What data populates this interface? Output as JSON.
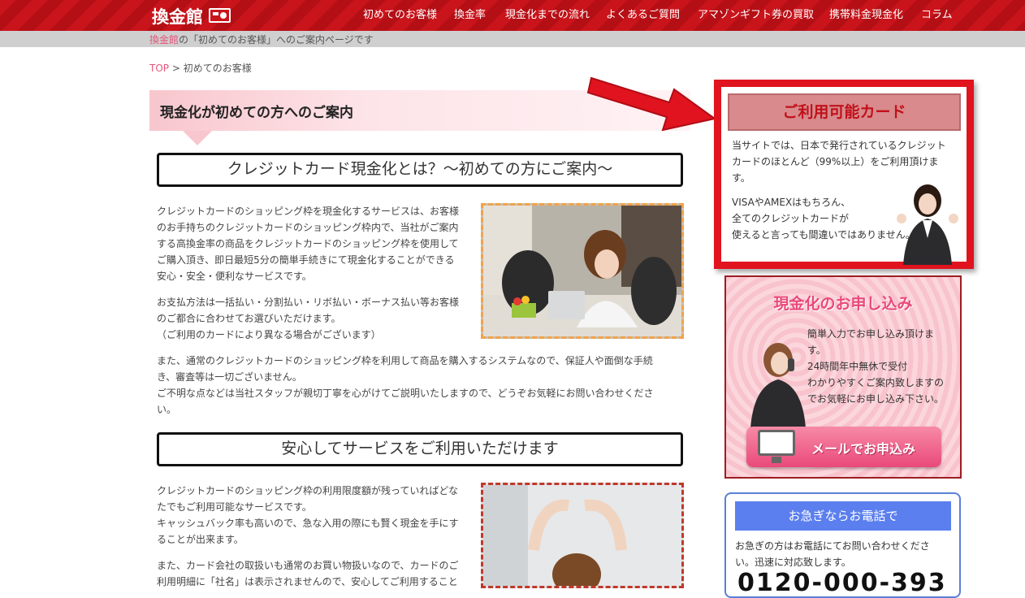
{
  "header": {
    "logo": "換金館",
    "nav": [
      "初めてのお客様",
      "換金率",
      "現金化までの流れ",
      "よくあるご質問",
      "アマゾンギフト券の買取",
      "携帯料金現金化",
      "コラム"
    ]
  },
  "subbar": {
    "site": "換金館",
    "rest": "の「初めてのお客様」へのご案内ページです"
  },
  "breadcrumb": {
    "top": "TOP",
    "sep": ">",
    "current": "初めてのお客様"
  },
  "page_heading": "現金化が初めての方へのご案内",
  "section1": {
    "heading": "クレジットカード現金化とは？〜初めての方にご案内〜",
    "p1": [
      "クレジットカードのショッピング枠を現金化するサービスは、お客様",
      "のお手持ちのクレジットカードのショッピング枠内で、当社がご案内",
      "する高換金率の商品をクレジットカードのショッピング枠を使用して",
      "ご購入頂き、即日最短5分の簡単手続きにて現金化することができる",
      "安心・安全・便利なサービスです。"
    ],
    "p2": [
      "お支払方法は一括払い・分割払い・リボ払い・ボーナス払い等お客様",
      "のご都合に合わせてお選びいただけます。",
      "（ご利用のカードにより異なる場合がございます）"
    ],
    "p3": [
      "また、通常のクレジットカードのショッピング枠を利用して商品を購入するシステムなので、保証人や面倒な手続",
      "き、審査等は一切ございません。",
      "ご不明な点などは当社スタッフが親切丁寧を心がけてご説明いたしますので、どうぞお気軽にお問い合わせくださ",
      "い。"
    ]
  },
  "section2": {
    "heading": "安心してサービスをご利用いただけます",
    "p1": [
      "クレジットカードのショッピング枠の利用限度額が残っていればどな",
      "たでもご利用可能なサービスです。",
      "キャッシュバック率も高いので、急な入用の際にも賢く現金を手にす",
      "ることが出来ます。"
    ],
    "p2": [
      "また、カード会社の取扱いも通常のお買い物扱いなので、カードのご",
      "利用明細に「社名」は表示されませんので、安心してご利用すること"
    ]
  },
  "sidebar": {
    "cards": {
      "title": "ご利用可能カード",
      "text1": [
        "当サイトでは、日本で発行されているクレジット",
        "カードのほとんど（99%以上）をご利用頂けま",
        "す。"
      ],
      "text2": [
        "VISAやAMEXはもちろん、",
        "全てのクレジットカードが",
        "使えると言っても間違いではありません。"
      ]
    },
    "apply": {
      "title": "現金化のお申し込み",
      "text": [
        "簡単入力でお申し込み頂けま",
        "す。",
        "24時間年中無休で受付",
        "わかりやすくご案内致しますの",
        "でお気軽にお申し込み下さい。"
      ],
      "button": "メールでお申込み"
    },
    "tel": {
      "title": "お急ぎならお電話で",
      "text": [
        "お急ぎの方はお電話にてお問い合わせくださ",
        "い。迅速に対応致します。"
      ],
      "number": "0120-000-393"
    }
  },
  "colors": {
    "brand": "#c9141b",
    "accent_pink": "#e8547a",
    "tel_blue": "#5b7fee"
  }
}
